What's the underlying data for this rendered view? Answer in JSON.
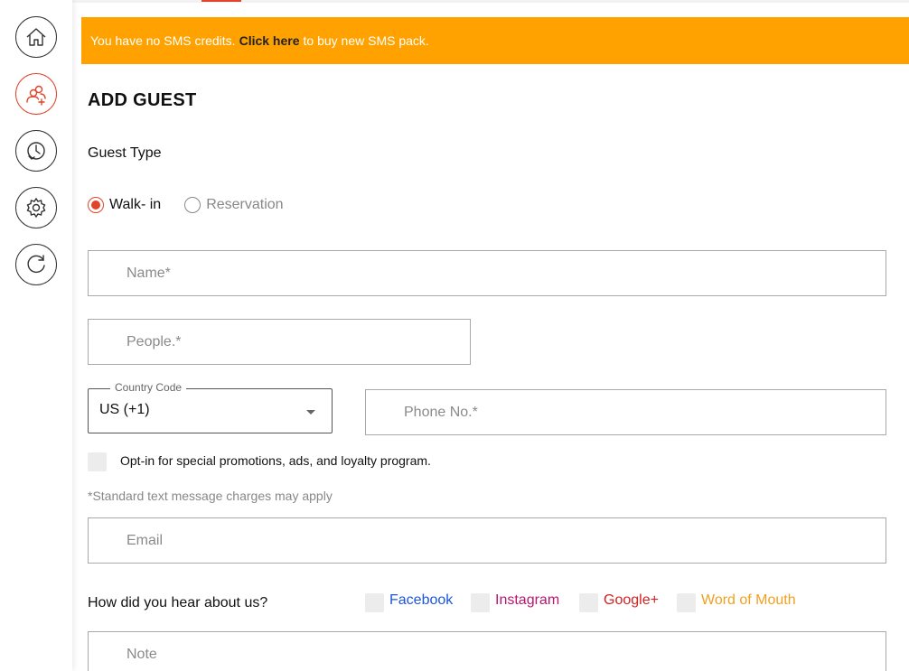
{
  "banner": {
    "prefix": "You have no SMS credits.",
    "link": "Click here",
    "suffix": "to buy new SMS pack.",
    "color": "#ffa200"
  },
  "sidebar": {
    "items": [
      {
        "name": "home-icon",
        "active": false
      },
      {
        "name": "add-guest-icon",
        "active": true
      },
      {
        "name": "history-icon",
        "active": false
      },
      {
        "name": "settings-icon",
        "active": false
      },
      {
        "name": "refresh-icon",
        "active": false
      }
    ],
    "accent": "#e0442a"
  },
  "form": {
    "title": "ADD GUEST",
    "guest_type_label": "Guest Type",
    "radios": {
      "walkin": "Walk- in",
      "reservation": "Reservation",
      "selected": "walkin"
    },
    "name_placeholder": "Name*",
    "people_placeholder": "People.*",
    "country_code_label": "Country Code",
    "country_code_value": "US (+1)",
    "phone_placeholder": "Phone No.*",
    "optin_text": "Opt-in for special promotions, ads, and loyalty program.",
    "disclaimer": "*Standard text message charges may apply",
    "email_placeholder": "Email",
    "hear_label": "How did you hear about us?",
    "sources": {
      "facebook": {
        "label": "Facebook",
        "color": "#1a56db"
      },
      "instagram": {
        "label": "Instagram",
        "color": "#b5176f"
      },
      "google": {
        "label": "Google+",
        "color": "#d42020"
      },
      "word_of_mouth": {
        "label": "Word of Mouth",
        "color": "#f0a020"
      }
    },
    "note_placeholder": "Note"
  }
}
